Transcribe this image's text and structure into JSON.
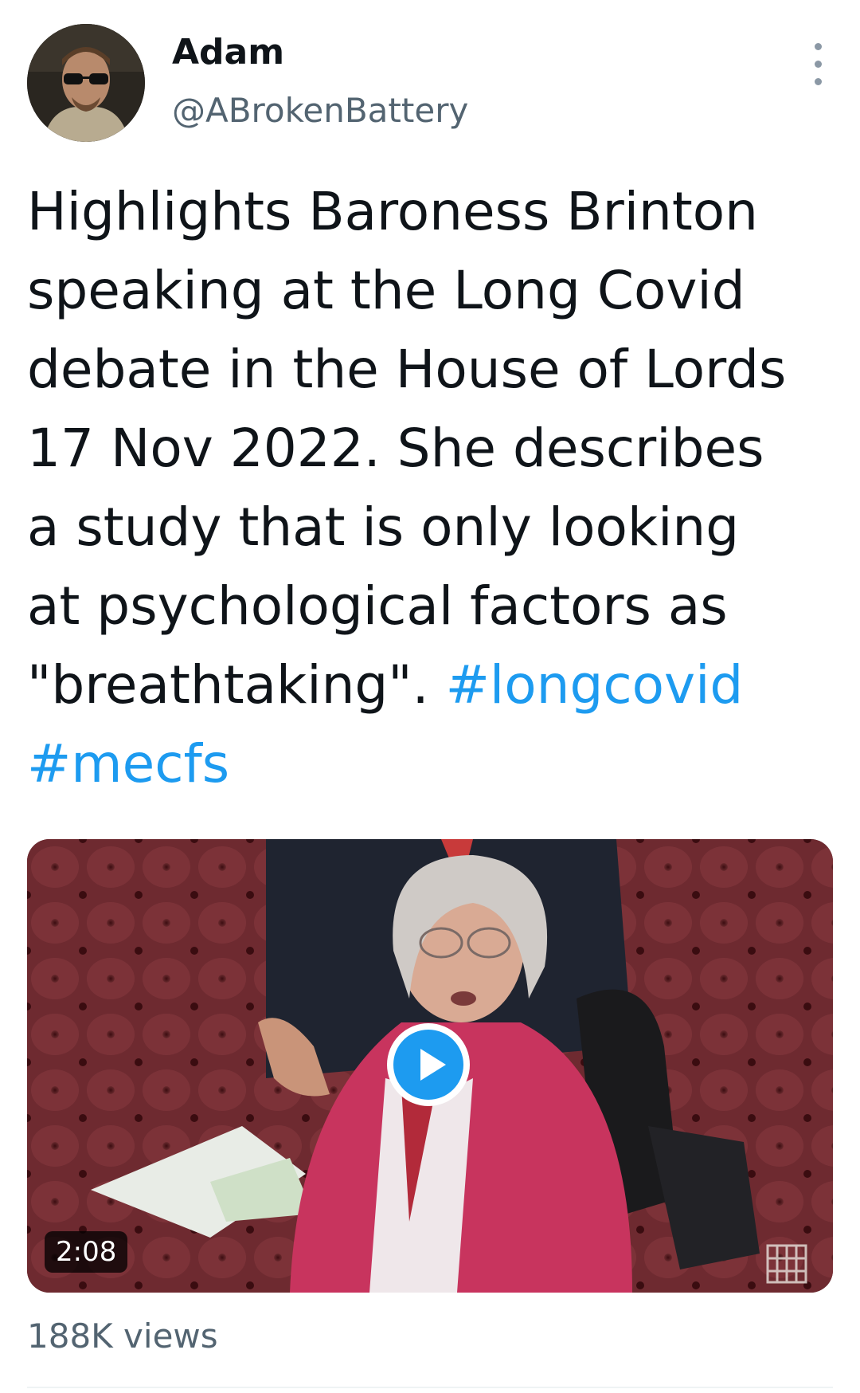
{
  "tweet": {
    "author": {
      "display_name": "Adam",
      "handle": "@ABrokenBattery"
    },
    "text_lines": [
      "Highlights Baroness Brinton",
      "speaking at the Long Covid",
      "debate in the House of Lords",
      "17 Nov 2022. She describes",
      "a study that is only looking",
      "at psychological factors as",
      "\"breathtaking\". "
    ],
    "hashtags": [
      "#longcovid",
      "#mecfs"
    ],
    "video": {
      "duration": "2:08"
    },
    "views": "188K views"
  },
  "colors": {
    "hashtag": "#1d9bf0",
    "play_button": "#1d9bf0",
    "secondary_text": "#536471"
  },
  "icons": {
    "more": "more-vertical-icon",
    "play": "play-icon",
    "watermark": "portcullis-icon"
  }
}
